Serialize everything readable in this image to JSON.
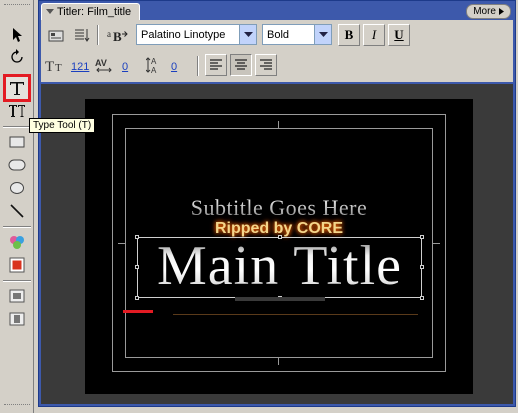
{
  "palette": {
    "tools": [
      {
        "name": "selection-tool",
        "icon": "arrow-pointer-icon"
      },
      {
        "name": "rotation-tool",
        "icon": "rotate-icon"
      },
      {
        "name": "type-tool",
        "icon": "type-t-icon",
        "selected": true
      },
      {
        "name": "vertical-type-tool",
        "icon": "vertical-type-icon"
      },
      {
        "name": "rectangle-tool",
        "icon": "rectangle-icon"
      },
      {
        "name": "rounded-rectangle-tool",
        "icon": "rounded-rectangle-icon"
      },
      {
        "name": "ellipse-tool",
        "icon": "ellipse-icon"
      },
      {
        "name": "line-tool",
        "icon": "line-icon"
      },
      {
        "name": "styles-tool",
        "icon": "styles-icon"
      },
      {
        "name": "fill-color-tool",
        "icon": "color-swatch-icon"
      },
      {
        "name": "align-tool",
        "icon": "align-icon"
      },
      {
        "name": "distribute-tool",
        "icon": "distribute-icon"
      }
    ],
    "tooltip": "Type Tool (T)"
  },
  "panel": {
    "tab_title": "Titler: Film_title",
    "more_label": "More",
    "font_family": "Palatino Linotype",
    "font_style": "Bold",
    "bold_label": "B",
    "italic_label": "I",
    "underline_label": "U",
    "font_size": "121",
    "kerning": "0",
    "leading": "0"
  },
  "canvas": {
    "subtitle": "Subtitle Goes Here",
    "watermark": "Ripped by CORE",
    "main_title": "Main Title"
  },
  "colors": {
    "panel_frame": "#3d59ab",
    "selection_highlight": "#e31b23",
    "canvas_background": "#000000",
    "watermark_text": "#f4d58a"
  }
}
